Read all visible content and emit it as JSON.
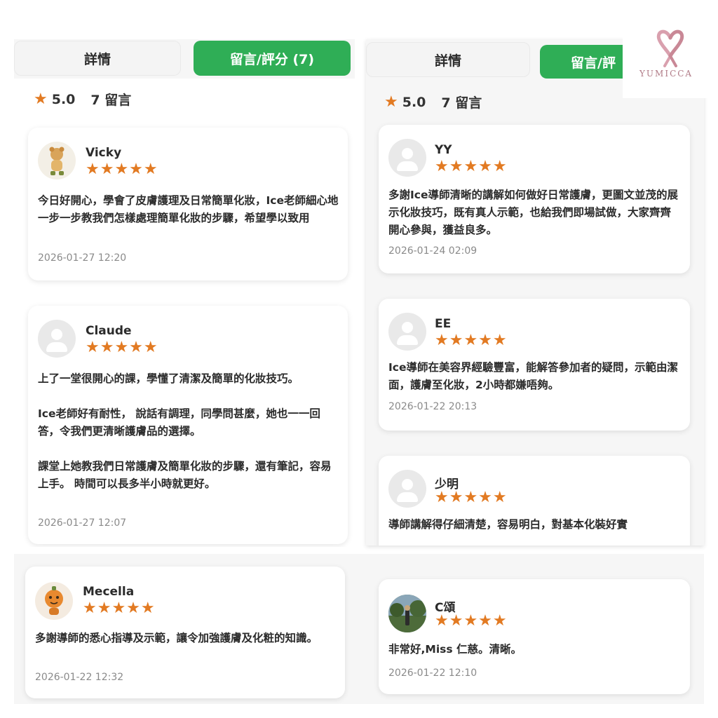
{
  "left": {
    "tabs": {
      "details": "詳情",
      "reviews": "留言/評分 (7)"
    },
    "summary": {
      "star": "★",
      "rating": "5.0",
      "count": "7 留言"
    },
    "reviews": [
      {
        "name": "Vicky",
        "stars": "★★★★★",
        "text": "今日好開心，學會了皮膚護理及日常簡單化妝，Ice老師細心地一步一步教我們怎樣處理簡單化妝的步驟，希望學以致用",
        "date": "2026-01-27 12:20"
      },
      {
        "name": "Claude",
        "stars": "★★★★★",
        "text": "上了一堂很開心的課，學懂了清潔及簡單的化妝技巧。\n\nIce老師好有耐性， 說話有調理，同學問甚麼，她也一一回答，令我們更清晰護膚品的選擇。\n\n課堂上她教我們日常護膚及簡單化妝的步驟，還有筆記，容易上手。 時間可以長多半小時就更好。",
        "date": "2026-01-27 12:07"
      },
      {
        "name": "Mecella",
        "stars": "★★★★★",
        "text": "多謝導師的悉心指導及示範，讓令加強護膚及化粧的知識。",
        "date": "2026-01-22 12:32"
      }
    ]
  },
  "right": {
    "tabs": {
      "details": "詳情",
      "reviews": "留言/評"
    },
    "summary": {
      "star": "★",
      "rating": "5.0",
      "count": "7 留言"
    },
    "reviews": [
      {
        "name": "YY",
        "stars": "★★★★★",
        "text": "多謝Ice導師清晰的講解如何做好日常護膚，更圖文並茂的展示化妝技巧，既有真人示範，也給我們即場試做，大家齊齊開心參與，獲益良多。",
        "date": "2026-01-24 02:09"
      },
      {
        "name": "EE",
        "stars": "★★★★★",
        "text": "Ice導師在美容界經驗豐富，能解答參加者的疑問，示範由潔面，護膚至化妝，2小時都嫌唔夠。",
        "date": "2026-01-22 20:13"
      },
      {
        "name": "少明",
        "stars": "★★★★★",
        "text": "導師講解得仔細清楚，容易明白，對基本化裝好實",
        "date": ""
      },
      {
        "name": "C頌",
        "stars": "★★★★★",
        "text": "非常好,Miss 仁慈。清晰。",
        "date": "2026-01-22 12:10"
      }
    ]
  },
  "logo": {
    "text": "YUMICCA"
  },
  "colors": {
    "accent_green": "#2fae56",
    "star_orange": "#e27a22",
    "logo_pink": "#d9a0ae"
  }
}
